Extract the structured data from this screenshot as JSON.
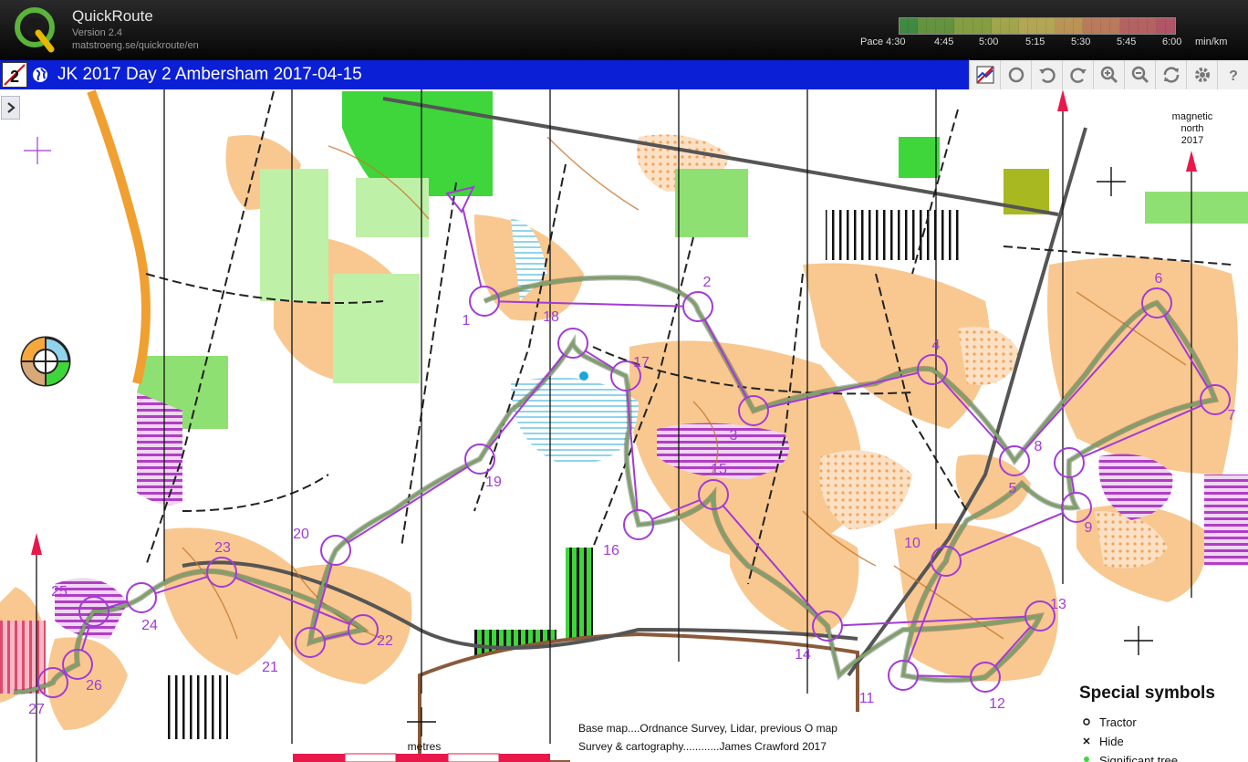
{
  "app": {
    "name": "QuickRoute",
    "version": "Version 2.4",
    "url": "matstroeng.se/quickroute/en"
  },
  "pace": {
    "labels": [
      "Pace 4:30",
      "4:45",
      "5:00",
      "5:15",
      "5:30",
      "5:45",
      "6:00",
      "min/km"
    ],
    "gradient_colors": [
      "#4caf50",
      "#7cbc4c",
      "#a8ca4f",
      "#cfd45c",
      "#e6d56a",
      "#efbd6a",
      "#ee9b72",
      "#e87a7a",
      "#e36a80"
    ]
  },
  "session": {
    "title": "JK 2017 Day 2 Ambersham 2017-04-15",
    "badge": "2"
  },
  "toolbar": {
    "buttons": [
      "route-toggle",
      "circle",
      "undo",
      "redo",
      "zoom-in",
      "zoom-out",
      "refresh",
      "settings",
      "help"
    ]
  },
  "map": {
    "magnetic_north": [
      "magnetic",
      "north",
      "2017"
    ],
    "controls": [
      {
        "label": "1"
      },
      {
        "label": "2"
      },
      {
        "label": "3"
      },
      {
        "label": "4"
      },
      {
        "label": "5"
      },
      {
        "label": "6"
      },
      {
        "label": "7"
      },
      {
        "label": "8"
      },
      {
        "label": "9"
      },
      {
        "label": "10"
      },
      {
        "label": "11"
      },
      {
        "label": "12"
      },
      {
        "label": "13"
      },
      {
        "label": "14"
      },
      {
        "label": "15"
      },
      {
        "label": "16"
      },
      {
        "label": "17"
      },
      {
        "label": "18"
      },
      {
        "label": "19"
      },
      {
        "label": "20"
      },
      {
        "label": "21"
      },
      {
        "label": "22"
      },
      {
        "label": "23"
      },
      {
        "label": "24"
      },
      {
        "label": "25"
      },
      {
        "label": "26"
      },
      {
        "label": "27"
      }
    ],
    "special_symbols": {
      "title": "Special symbols",
      "items": [
        "Tractor",
        "Hide",
        "Significant tree"
      ]
    },
    "credits": [
      "Base map....Ordnance Survey, Lidar, previous O map",
      "Survey & cartography............James Crawford 2017"
    ],
    "scale_label": "metres"
  },
  "colors": {
    "course": "#a23bd6",
    "route": "#6b8a5a",
    "title_bar": "#0a1fd6",
    "open_land": "#f8c890",
    "forest_green": "#3ed63a"
  }
}
